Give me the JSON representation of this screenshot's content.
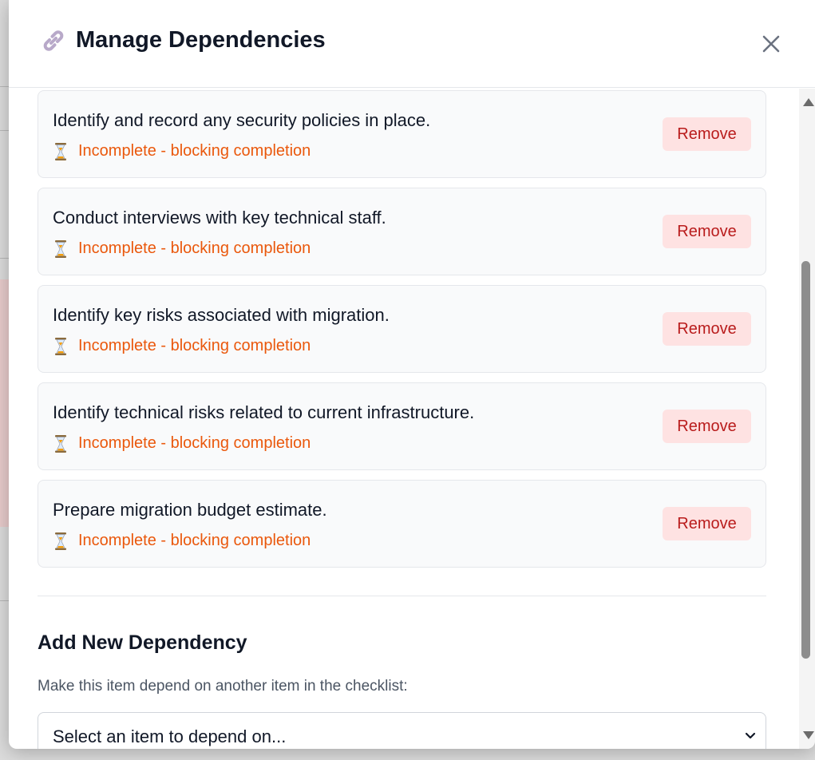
{
  "modal": {
    "title": "Manage Dependencies",
    "icon": "link-icon",
    "close_icon": "close-icon"
  },
  "dependencies": [
    {
      "title": "Identify and record any security policies in place.",
      "status": "Incomplete - blocking completion",
      "remove_label": "Remove"
    },
    {
      "title": "Conduct interviews with key technical staff.",
      "status": "Incomplete - blocking completion",
      "remove_label": "Remove"
    },
    {
      "title": "Identify key risks associated with migration.",
      "status": "Incomplete - blocking completion",
      "remove_label": "Remove"
    },
    {
      "title": "Identify technical risks related to current infrastructure.",
      "status": "Incomplete - blocking completion",
      "remove_label": "Remove"
    },
    {
      "title": "Prepare migration budget estimate.",
      "status": "Incomplete - blocking completion",
      "remove_label": "Remove"
    }
  ],
  "add_section": {
    "title": "Add New Dependency",
    "description": "Make this item depend on another item in the checklist:",
    "select_value": "Select an item to depend on..."
  },
  "colors": {
    "status_incomplete": "#ea580c",
    "remove_bg": "#fee2e2",
    "remove_text": "#b91c1c"
  }
}
